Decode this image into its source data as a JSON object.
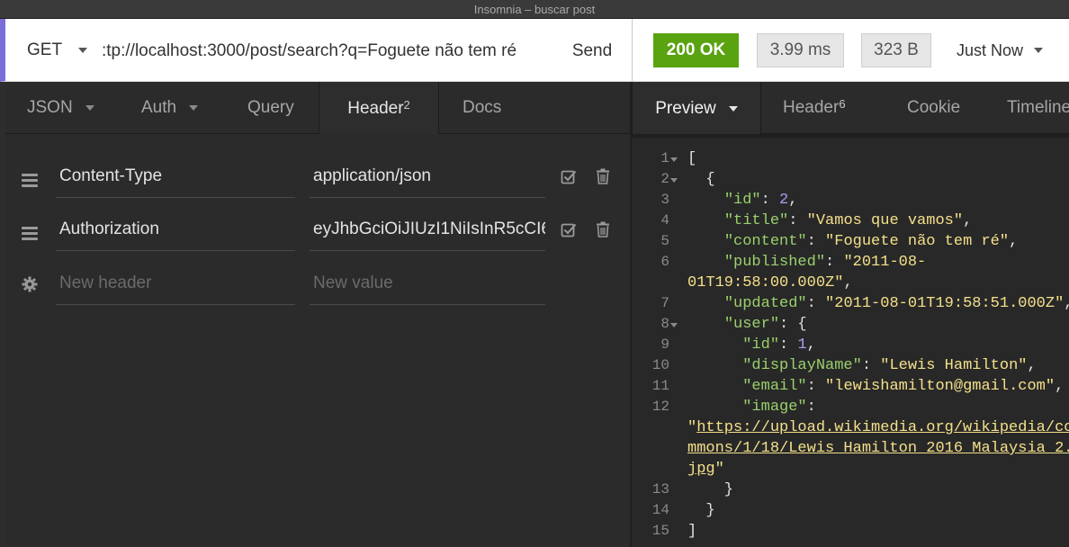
{
  "window": {
    "title": "Insomnia – buscar post"
  },
  "request": {
    "method": "GET",
    "url": ":tp://localhost:3000/post/search?q=Foguete não tem ré",
    "send_label": "Send",
    "tabs": [
      {
        "label": "JSON"
      },
      {
        "label": "Auth"
      },
      {
        "label": "Query"
      },
      {
        "label": "Header",
        "badge": "2"
      },
      {
        "label": "Docs"
      }
    ],
    "headers": [
      {
        "name": "Content-Type",
        "value": "application/json"
      },
      {
        "name": "Authorization",
        "value": "eyJhbGciOiJIUzI1NiIsInR5cCI6"
      }
    ],
    "new_header_placeholder": "New header",
    "new_value_placeholder": "New value"
  },
  "response": {
    "status": "200 OK",
    "time": "3.99 ms",
    "size": "323 B",
    "when": "Just Now",
    "tabs": [
      {
        "label": "Preview"
      },
      {
        "label": "Header",
        "badge": "6"
      },
      {
        "label": "Cookie"
      },
      {
        "label": "Timeline"
      }
    ],
    "lines": [
      "1",
      "2",
      "3",
      "4",
      "5",
      "6",
      "7",
      "8",
      "9",
      "10",
      "11",
      "12",
      "13",
      "14",
      "15"
    ],
    "body": {
      "l1": "[",
      "l2": "{",
      "id_key": "\"id\"",
      "id_val": "2",
      "title_key": "\"title\"",
      "title_val": "\"Vamos que vamos\"",
      "content_key": "\"content\"",
      "content_val": "\"Foguete não tem ré\"",
      "published_key": "\"published\"",
      "published_val_a": "\"2011-08-",
      "published_val_b": "01T19:58:00.000Z\"",
      "updated_key": "\"updated\"",
      "updated_val": "\"2011-08-01T19:58:51.000Z\"",
      "user_key": "\"user\"",
      "uid_key": "\"id\"",
      "uid_val": "1",
      "display_key": "\"displayName\"",
      "display_val": "\"Lewis Hamilton\"",
      "email_key": "\"email\"",
      "email_val": "\"lewishamilton@gmail.com\"",
      "image_key": "\"image\"",
      "image_url_a": "https://upload.wikimedia.org/wikipedia/co",
      "image_url_b": "mmons/1/18/Lewis_Hamilton_2016_Malaysia_2.",
      "image_url_c": "jpg"
    }
  }
}
